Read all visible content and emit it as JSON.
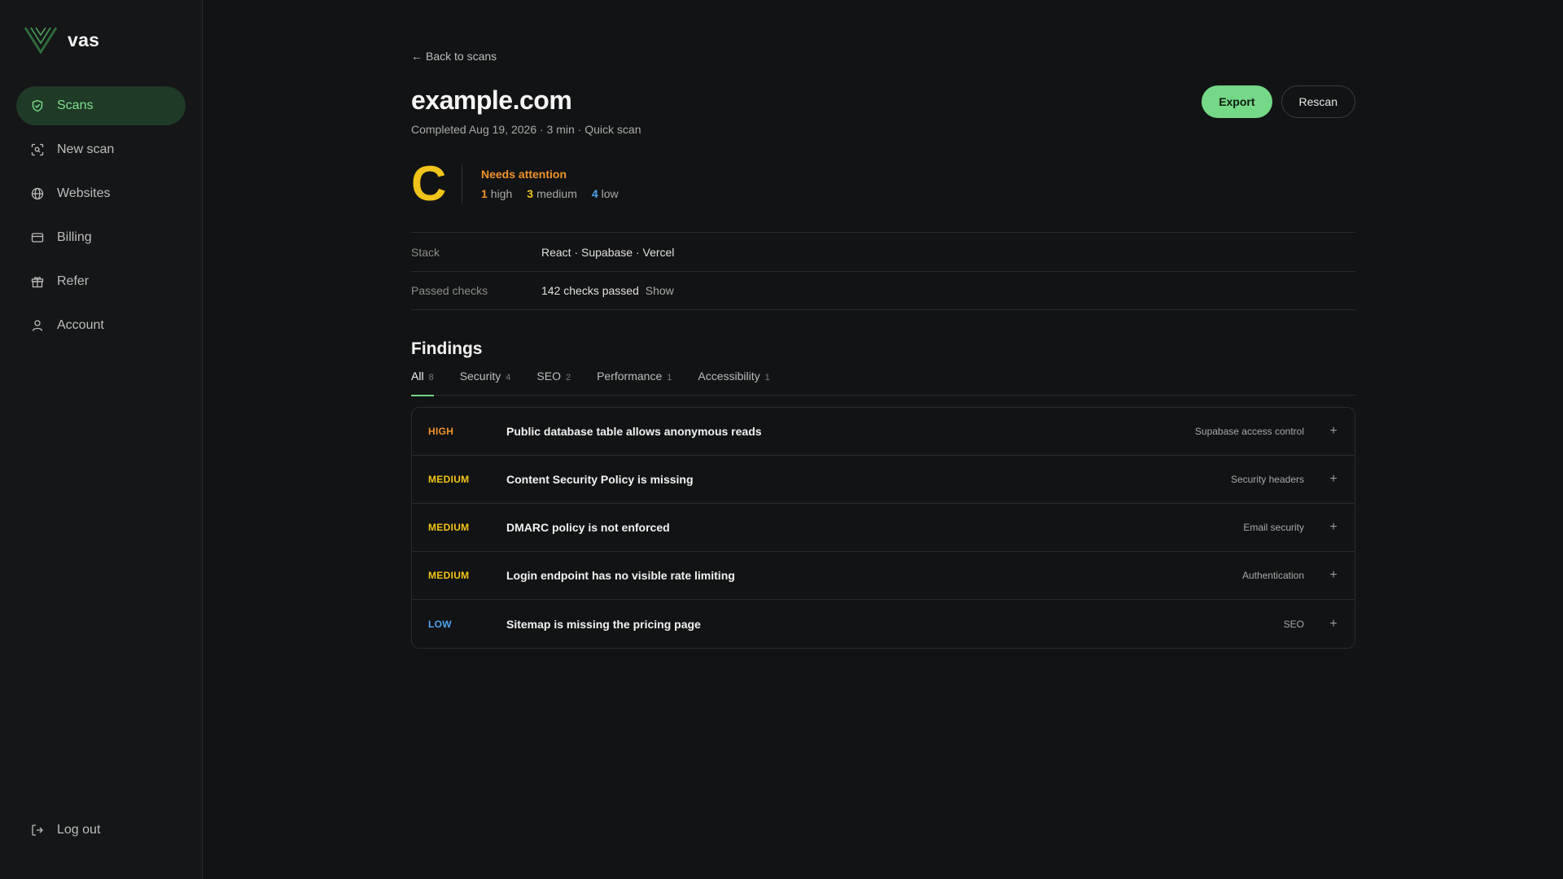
{
  "app": {
    "name": "vas"
  },
  "sidebar": {
    "items": [
      {
        "label": "Scans",
        "icon": "shield-check-icon",
        "active": true
      },
      {
        "label": "New scan",
        "icon": "scan-icon"
      },
      {
        "label": "Websites",
        "icon": "globe-icon"
      },
      {
        "label": "Billing",
        "icon": "credit-card-icon"
      },
      {
        "label": "Refer",
        "icon": "gift-icon"
      },
      {
        "label": "Account",
        "icon": "user-icon"
      }
    ],
    "logout": {
      "label": "Log out",
      "icon": "logout-icon"
    }
  },
  "header": {
    "back_label": "Back to scans",
    "title": "example.com",
    "subtitle": "Completed Aug 19, 2026 · 3 min · Quick scan",
    "export_label": "Export",
    "rescan_label": "Rescan"
  },
  "grade": {
    "letter": "C",
    "status": "Needs attention",
    "counts": {
      "high": {
        "value": "1",
        "label": "high"
      },
      "medium": {
        "value": "3",
        "label": "medium"
      },
      "low": {
        "value": "4",
        "label": "low"
      }
    }
  },
  "meta": {
    "stack_label": "Stack",
    "stack_value": "React · Supabase · Vercel",
    "passed_label": "Passed checks",
    "passed_value": "142 checks passed",
    "show_label": "Show"
  },
  "findings": {
    "title": "Findings",
    "tabs": [
      {
        "label": "All",
        "count": "8",
        "active": true
      },
      {
        "label": "Security",
        "count": "4"
      },
      {
        "label": "SEO",
        "count": "2"
      },
      {
        "label": "Performance",
        "count": "1"
      },
      {
        "label": "Accessibility",
        "count": "1"
      }
    ],
    "items": [
      {
        "severity": "HIGH",
        "title": "Public database table allows anonymous reads",
        "category": "Supabase access control"
      },
      {
        "severity": "MEDIUM",
        "title": "Content Security Policy is missing",
        "category": "Security headers"
      },
      {
        "severity": "MEDIUM",
        "title": "DMARC policy is not enforced",
        "category": "Email security"
      },
      {
        "severity": "MEDIUM",
        "title": "Login endpoint has no visible rate limiting",
        "category": "Authentication"
      },
      {
        "severity": "LOW",
        "title": "Sitemap is missing the pricing page",
        "category": "SEO"
      }
    ],
    "expand_symbol": "+"
  },
  "colors": {
    "accent": "#74d886",
    "high": "#f0932b",
    "medium": "#f0c419",
    "low": "#4ea3f0",
    "background": "#121314"
  }
}
